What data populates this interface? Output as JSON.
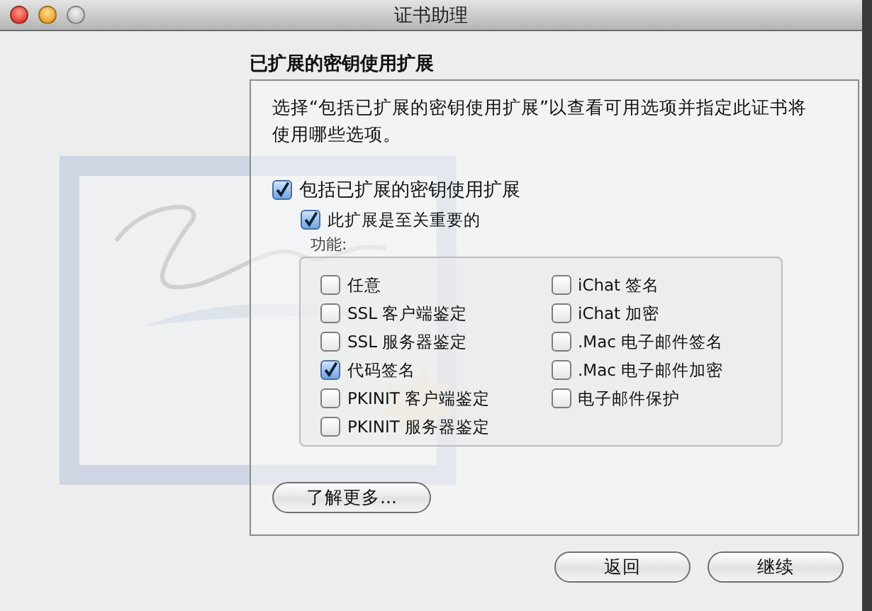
{
  "window": {
    "title": "证书助理"
  },
  "section_title": "已扩展的密钥使用扩展",
  "description": "选择“包括已扩展的密钥使用扩展”以查看可用选项并指定此证书将使用哪些选项。",
  "include_extension": {
    "label": "包括已扩展的密钥使用扩展",
    "checked": true
  },
  "critical": {
    "label": "此扩展是至关重要的",
    "checked": true
  },
  "capabilities": {
    "label": "功能:",
    "column_1": [
      {
        "label": "任意",
        "checked": false
      },
      {
        "label": "SSL 客户端鉴定",
        "checked": false
      },
      {
        "label": "SSL 服务器鉴定",
        "checked": false
      },
      {
        "label": "代码签名",
        "checked": true
      },
      {
        "label": "PKINIT 客户端鉴定",
        "checked": false
      },
      {
        "label": "PKINIT 服务器鉴定",
        "checked": false
      }
    ],
    "column_2": [
      {
        "label": "iChat 签名",
        "checked": false
      },
      {
        "label": "iChat 加密",
        "checked": false
      },
      {
        "label": ".Mac 电子邮件签名",
        "checked": false
      },
      {
        "label": ".Mac 电子邮件加密",
        "checked": false
      },
      {
        "label": "电子邮件保护",
        "checked": false
      }
    ]
  },
  "learn_more_button": "了解更多...",
  "buttons": [
    "返回",
    "继续"
  ]
}
